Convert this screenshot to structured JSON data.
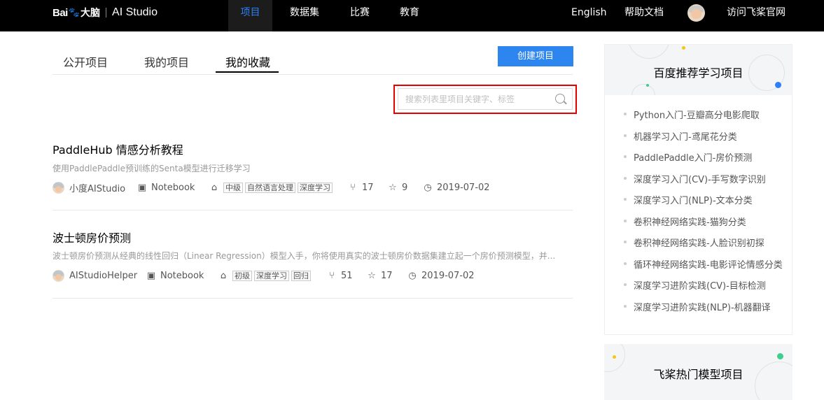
{
  "header": {
    "logo_brand": "Bai",
    "logo_du": "大脑",
    "logo_product": "AI Studio",
    "nav": [
      "项目",
      "数据集",
      "比赛",
      "教育"
    ],
    "language": "English",
    "help": "帮助文档",
    "visit": "访问飞桨官网"
  },
  "tabs": [
    "公开项目",
    "我的项目",
    "我的收藏"
  ],
  "create_button": "创建项目",
  "search": {
    "placeholder": "搜索列表里项目关键字、标签",
    "value": ""
  },
  "projects": [
    {
      "title": "PaddleHub 情感分析教程",
      "desc": "使用PaddlePaddle预训练的Senta模型进行迁移学习",
      "author": "小度AIStudio",
      "type": "Notebook",
      "tags": [
        "中级",
        "自然语言处理",
        "深度学习"
      ],
      "forks": "17",
      "stars": "9",
      "date": "2019-07-02"
    },
    {
      "title": "波士顿房价预测",
      "desc": "波士顿房价预测从经典的线性回归（Linear Regression）模型入手，你将使用真实的波士顿房价数据集建立起一个房价预测模型，并...",
      "author": "AIStudioHelper",
      "type": "Notebook",
      "tags": [
        "初级",
        "深度学习",
        "回归"
      ],
      "forks": "51",
      "stars": "17",
      "date": "2019-07-02"
    }
  ],
  "sidebar": {
    "title": "百度推荐学习项目",
    "items": [
      "Python入门-豆瓣高分电影爬取",
      "机器学习入门-鸢尾花分类",
      "PaddlePaddle入门-房价预测",
      "深度学习入门(CV)-手写数字识别",
      "深度学习入门(NLP)-文本分类",
      "卷积神经网络实践-猫狗分类",
      "卷积神经网络实践-人脸识别初探",
      "循环神经网络实践-电影评论情感分类",
      "深度学习进阶实践(CV)-目标检测",
      "深度学习进阶实践(NLP)-机器翻译"
    ],
    "second_title": "飞桨热门模型项目"
  },
  "colors": {
    "accent": "#2d86f0",
    "nav_active": "#2d7ff9",
    "highlight": "#e60000"
  }
}
